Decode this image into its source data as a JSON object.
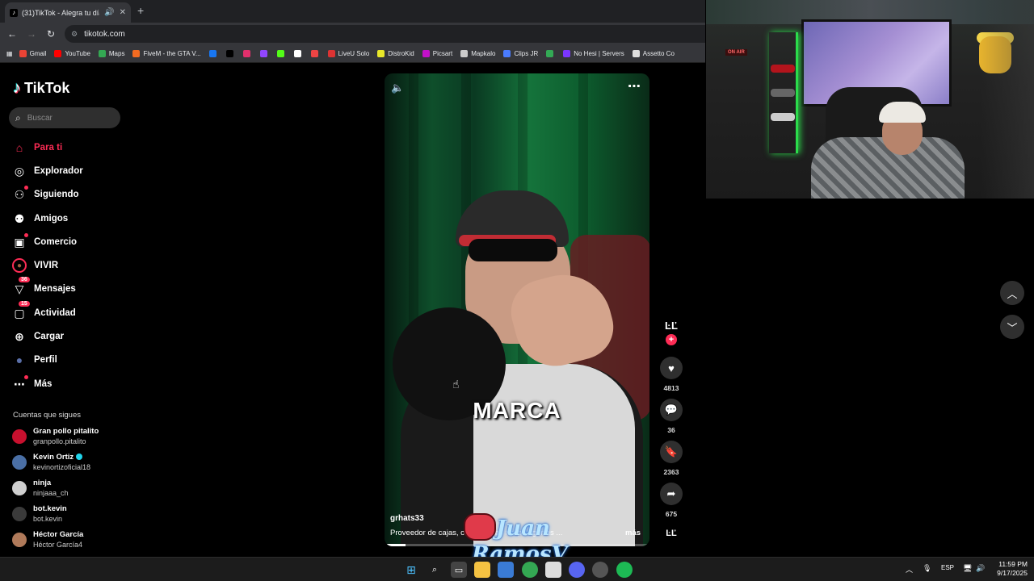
{
  "browser": {
    "tab_title": "(31)TikTok - Alegra tu día",
    "url": "tikotok.com",
    "bookmarks": [
      {
        "label": "Gmail",
        "color": "#ea4335"
      },
      {
        "label": "YouTube",
        "color": "#ff0000"
      },
      {
        "label": "Maps",
        "color": "#34a853"
      },
      {
        "label": "FiveM - the GTA V...",
        "color": "#f26b21"
      },
      {
        "label": "",
        "color": "#1877f2"
      },
      {
        "label": "",
        "color": "#000000"
      },
      {
        "label": "",
        "color": "#e1306c"
      },
      {
        "label": "",
        "color": "#9146ff"
      },
      {
        "label": "",
        "color": "#53fc18"
      },
      {
        "label": "",
        "color": "#ffffff"
      },
      {
        "label": "",
        "color": "#e44"
      },
      {
        "label": "LiveU Solo",
        "color": "#d33"
      },
      {
        "label": "DistroKid",
        "color": "#e8e82a"
      },
      {
        "label": "Picsart",
        "color": "#c210c8"
      },
      {
        "label": "Mapkalo",
        "color": "#cccccc"
      },
      {
        "label": "Clips JR",
        "color": "#4a7cff"
      },
      {
        "label": "",
        "color": "#33aa55"
      },
      {
        "label": "No Hesi | Servers",
        "color": "#7a36ff"
      },
      {
        "label": "Assetto Co",
        "color": "#dddddd"
      }
    ]
  },
  "sidebar": {
    "logo": "TikTok",
    "search_placeholder": "Buscar",
    "nav": [
      {
        "label": "Para ti",
        "icon": "home-icon",
        "active": true
      },
      {
        "label": "Explorador",
        "icon": "compass-icon"
      },
      {
        "label": "Siguiendo",
        "icon": "following-icon"
      },
      {
        "label": "Amigos",
        "icon": "friends-icon"
      },
      {
        "label": "Comercio",
        "icon": "shop-icon"
      },
      {
        "label": "VIVIR",
        "icon": "live-avatar-icon"
      },
      {
        "label": "Mensajes",
        "icon": "messages-icon",
        "badge": "36"
      },
      {
        "label": "Actividad",
        "icon": "activity-icon",
        "badge": "15"
      },
      {
        "label": "Cargar",
        "icon": "upload-icon"
      },
      {
        "label": "Perfil",
        "icon": "profile-icon"
      },
      {
        "label": "Más",
        "icon": "more-icon"
      }
    ],
    "following_title": "Cuentas que sigues",
    "following": [
      {
        "name": "Gran pollo pitalito",
        "handle": "granpollo.pitalito",
        "color": "#c8102e"
      },
      {
        "name": "Kevin Ortiz",
        "handle": "kevinortizoficial18",
        "color": "#4a6fa5",
        "verified": true
      },
      {
        "name": "ninja",
        "handle": "ninjaaa_ch",
        "color": "#cfcfcf"
      },
      {
        "name": "bot.kevin",
        "handle": "bot.kevin",
        "color": "#3a3a3a"
      },
      {
        "name": "Héctor García",
        "handle": "Héctor García4",
        "color": "#b07a5a"
      }
    ]
  },
  "video": {
    "caption": "MARCA",
    "username": "grhats33",
    "description": "Proveedor de cajas, cu... #gorras #caps #gorras ...",
    "more_label": "más",
    "progress": 0.08
  },
  "actions": {
    "likes": "4813",
    "comments": "36",
    "saves": "2363",
    "shares": "675"
  },
  "webcam": {
    "sign": "ON AIR"
  },
  "watermark": {
    "line1": "Juan",
    "line2": "RamosV"
  },
  "taskbar": {
    "lang": "ESP",
    "time": "11:59 PM",
    "date": "9/17/2025"
  }
}
